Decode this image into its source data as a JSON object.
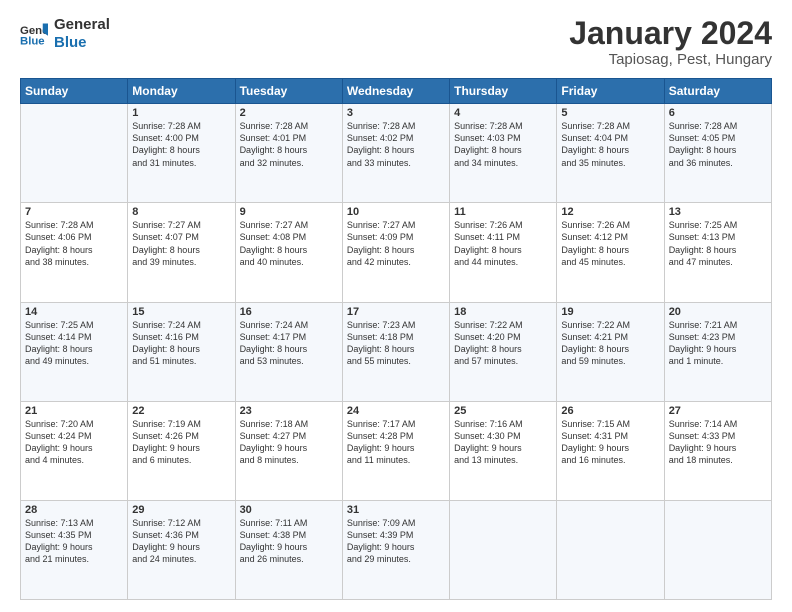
{
  "header": {
    "logo_text_general": "General",
    "logo_text_blue": "Blue",
    "main_title": "January 2024",
    "sub_title": "Tapiosag, Pest, Hungary"
  },
  "calendar": {
    "days_of_week": [
      "Sunday",
      "Monday",
      "Tuesday",
      "Wednesday",
      "Thursday",
      "Friday",
      "Saturday"
    ],
    "weeks": [
      [
        {
          "day": "",
          "info": ""
        },
        {
          "day": "1",
          "info": "Sunrise: 7:28 AM\nSunset: 4:00 PM\nDaylight: 8 hours\nand 31 minutes."
        },
        {
          "day": "2",
          "info": "Sunrise: 7:28 AM\nSunset: 4:01 PM\nDaylight: 8 hours\nand 32 minutes."
        },
        {
          "day": "3",
          "info": "Sunrise: 7:28 AM\nSunset: 4:02 PM\nDaylight: 8 hours\nand 33 minutes."
        },
        {
          "day": "4",
          "info": "Sunrise: 7:28 AM\nSunset: 4:03 PM\nDaylight: 8 hours\nand 34 minutes."
        },
        {
          "day": "5",
          "info": "Sunrise: 7:28 AM\nSunset: 4:04 PM\nDaylight: 8 hours\nand 35 minutes."
        },
        {
          "day": "6",
          "info": "Sunrise: 7:28 AM\nSunset: 4:05 PM\nDaylight: 8 hours\nand 36 minutes."
        }
      ],
      [
        {
          "day": "7",
          "info": "Sunrise: 7:28 AM\nSunset: 4:06 PM\nDaylight: 8 hours\nand 38 minutes."
        },
        {
          "day": "8",
          "info": "Sunrise: 7:27 AM\nSunset: 4:07 PM\nDaylight: 8 hours\nand 39 minutes."
        },
        {
          "day": "9",
          "info": "Sunrise: 7:27 AM\nSunset: 4:08 PM\nDaylight: 8 hours\nand 40 minutes."
        },
        {
          "day": "10",
          "info": "Sunrise: 7:27 AM\nSunset: 4:09 PM\nDaylight: 8 hours\nand 42 minutes."
        },
        {
          "day": "11",
          "info": "Sunrise: 7:26 AM\nSunset: 4:11 PM\nDaylight: 8 hours\nand 44 minutes."
        },
        {
          "day": "12",
          "info": "Sunrise: 7:26 AM\nSunset: 4:12 PM\nDaylight: 8 hours\nand 45 minutes."
        },
        {
          "day": "13",
          "info": "Sunrise: 7:25 AM\nSunset: 4:13 PM\nDaylight: 8 hours\nand 47 minutes."
        }
      ],
      [
        {
          "day": "14",
          "info": "Sunrise: 7:25 AM\nSunset: 4:14 PM\nDaylight: 8 hours\nand 49 minutes."
        },
        {
          "day": "15",
          "info": "Sunrise: 7:24 AM\nSunset: 4:16 PM\nDaylight: 8 hours\nand 51 minutes."
        },
        {
          "day": "16",
          "info": "Sunrise: 7:24 AM\nSunset: 4:17 PM\nDaylight: 8 hours\nand 53 minutes."
        },
        {
          "day": "17",
          "info": "Sunrise: 7:23 AM\nSunset: 4:18 PM\nDaylight: 8 hours\nand 55 minutes."
        },
        {
          "day": "18",
          "info": "Sunrise: 7:22 AM\nSunset: 4:20 PM\nDaylight: 8 hours\nand 57 minutes."
        },
        {
          "day": "19",
          "info": "Sunrise: 7:22 AM\nSunset: 4:21 PM\nDaylight: 8 hours\nand 59 minutes."
        },
        {
          "day": "20",
          "info": "Sunrise: 7:21 AM\nSunset: 4:23 PM\nDaylight: 9 hours\nand 1 minute."
        }
      ],
      [
        {
          "day": "21",
          "info": "Sunrise: 7:20 AM\nSunset: 4:24 PM\nDaylight: 9 hours\nand 4 minutes."
        },
        {
          "day": "22",
          "info": "Sunrise: 7:19 AM\nSunset: 4:26 PM\nDaylight: 9 hours\nand 6 minutes."
        },
        {
          "day": "23",
          "info": "Sunrise: 7:18 AM\nSunset: 4:27 PM\nDaylight: 9 hours\nand 8 minutes."
        },
        {
          "day": "24",
          "info": "Sunrise: 7:17 AM\nSunset: 4:28 PM\nDaylight: 9 hours\nand 11 minutes."
        },
        {
          "day": "25",
          "info": "Sunrise: 7:16 AM\nSunset: 4:30 PM\nDaylight: 9 hours\nand 13 minutes."
        },
        {
          "day": "26",
          "info": "Sunrise: 7:15 AM\nSunset: 4:31 PM\nDaylight: 9 hours\nand 16 minutes."
        },
        {
          "day": "27",
          "info": "Sunrise: 7:14 AM\nSunset: 4:33 PM\nDaylight: 9 hours\nand 18 minutes."
        }
      ],
      [
        {
          "day": "28",
          "info": "Sunrise: 7:13 AM\nSunset: 4:35 PM\nDaylight: 9 hours\nand 21 minutes."
        },
        {
          "day": "29",
          "info": "Sunrise: 7:12 AM\nSunset: 4:36 PM\nDaylight: 9 hours\nand 24 minutes."
        },
        {
          "day": "30",
          "info": "Sunrise: 7:11 AM\nSunset: 4:38 PM\nDaylight: 9 hours\nand 26 minutes."
        },
        {
          "day": "31",
          "info": "Sunrise: 7:09 AM\nSunset: 4:39 PM\nDaylight: 9 hours\nand 29 minutes."
        },
        {
          "day": "",
          "info": ""
        },
        {
          "day": "",
          "info": ""
        },
        {
          "day": "",
          "info": ""
        }
      ]
    ]
  }
}
